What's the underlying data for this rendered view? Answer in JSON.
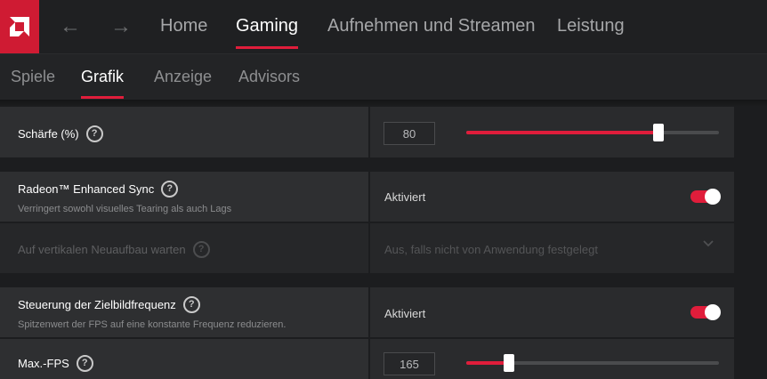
{
  "topbar": {
    "logo": "amd-logo",
    "back_icon": "←",
    "forward_icon": "→",
    "tabs": [
      {
        "label": "Home"
      },
      {
        "label": "Gaming"
      },
      {
        "label": "Aufnehmen und Streamen"
      },
      {
        "label": "Leistung"
      }
    ],
    "active_tab": "Gaming"
  },
  "subtabs": {
    "tabs": [
      {
        "label": "Spiele"
      },
      {
        "label": "Grafik"
      },
      {
        "label": "Anzeige"
      },
      {
        "label": "Advisors"
      }
    ],
    "active_tab": "Grafik"
  },
  "settings": {
    "sharpness": {
      "label": "Schärfe (%)",
      "value": "80",
      "fraction": 0.76
    },
    "enhanced_sync": {
      "label": "Radeon™ Enhanced Sync",
      "description": "Verringert sowohl visuelles Tearing als auch Lags",
      "status": "Aktiviert",
      "enabled": true
    },
    "vsync": {
      "label": "Auf vertikalen Neuaufbau warten",
      "value": "Aus, falls nicht von Anwendung festgelegt",
      "disabled": true
    },
    "frtc": {
      "label": "Steuerung der Zielbildfrequenz",
      "description": "Spitzenwert der FPS auf eine konstante Frequenz reduzieren.",
      "status": "Aktiviert",
      "enabled": true
    },
    "max_fps": {
      "label": "Max.-FPS",
      "value": "165",
      "fraction": 0.17
    }
  },
  "help_glyph": "?",
  "colors": {
    "accent": "#e01d3b",
    "logo_bg": "#cf1b33",
    "background": "#1c1d1f",
    "card": "#2a2b2d"
  }
}
